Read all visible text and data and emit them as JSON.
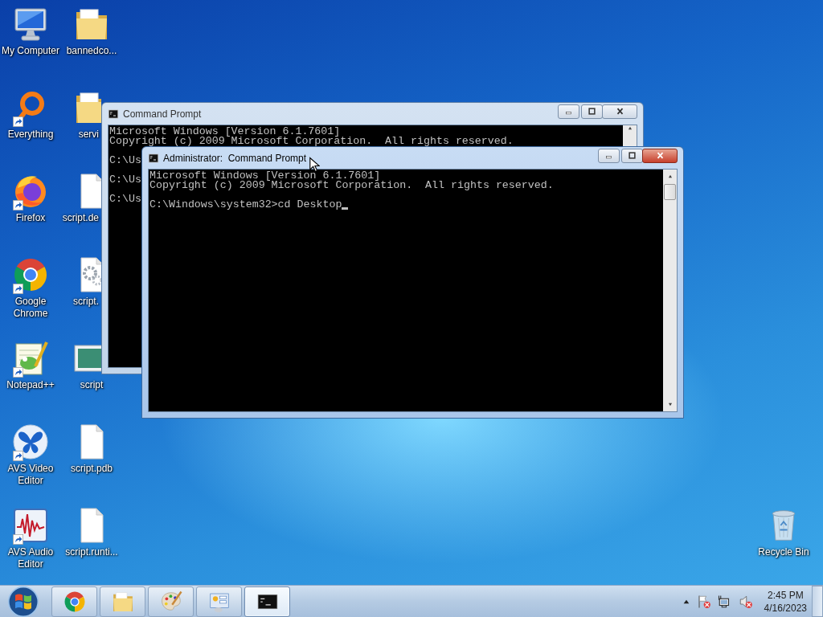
{
  "desktop_icons": [
    {
      "label": "My Computer",
      "kind": "computer",
      "shortcut": false
    },
    {
      "label": "bannedco...",
      "kind": "folder",
      "shortcut": false
    },
    {
      "label": "Everything",
      "kind": "ring",
      "shortcut": true
    },
    {
      "label": "servi",
      "kind": "folder",
      "shortcut": false
    },
    {
      "label": "Firefox",
      "kind": "fox",
      "shortcut": true
    },
    {
      "label": "script.de",
      "kind": "file",
      "shortcut": false
    },
    {
      "label": "Google Chrome",
      "kind": "browser",
      "shortcut": true
    },
    {
      "label": "script.",
      "kind": "gear-file",
      "shortcut": false
    },
    {
      "label": "Notepad++",
      "kind": "notepad",
      "shortcut": true
    },
    {
      "label": "script",
      "kind": "picture-file",
      "shortcut": false
    },
    {
      "label": "AVS Video Editor",
      "kind": "butterfly",
      "shortcut": true
    },
    {
      "label": "script.pdb",
      "kind": "file",
      "shortcut": false
    },
    {
      "label": "AVS Audio Editor",
      "kind": "waveform",
      "shortcut": true
    },
    {
      "label": "script.runti...",
      "kind": "file",
      "shortcut": false
    }
  ],
  "windows": [
    {
      "title": "Command Prompt",
      "active": false,
      "blocks": [
        [
          "Microsoft Windows [Version 6.1.7601]",
          "Copyright (c) 2009 Microsoft Corporation.  All rights reserved."
        ],
        [
          "C:\\Us"
        ],
        [
          "C:\\Us"
        ],
        [
          "C:\\Us"
        ]
      ]
    },
    {
      "title": "Administrator:  Command Prompt",
      "active": true,
      "cursor": true,
      "blocks": [
        [
          "Microsoft Windows [Version 6.1.7601]",
          "Copyright (c) 2009 Microsoft Corporation.  All rights reserved."
        ],
        [
          "C:\\Windows\\system32>cd Desktop"
        ]
      ]
    }
  ],
  "recycle_bin": {
    "label": "Recycle Bin"
  },
  "taskbar": {
    "items": [
      {
        "kind": "browser",
        "active": false
      },
      {
        "kind": "folder",
        "active": false
      },
      {
        "kind": "paint",
        "active": false
      },
      {
        "kind": "control-panel",
        "active": false
      },
      {
        "kind": "console",
        "active": true
      }
    ],
    "clock": {
      "time": "2:45 PM",
      "date": "4/16/2023"
    }
  }
}
